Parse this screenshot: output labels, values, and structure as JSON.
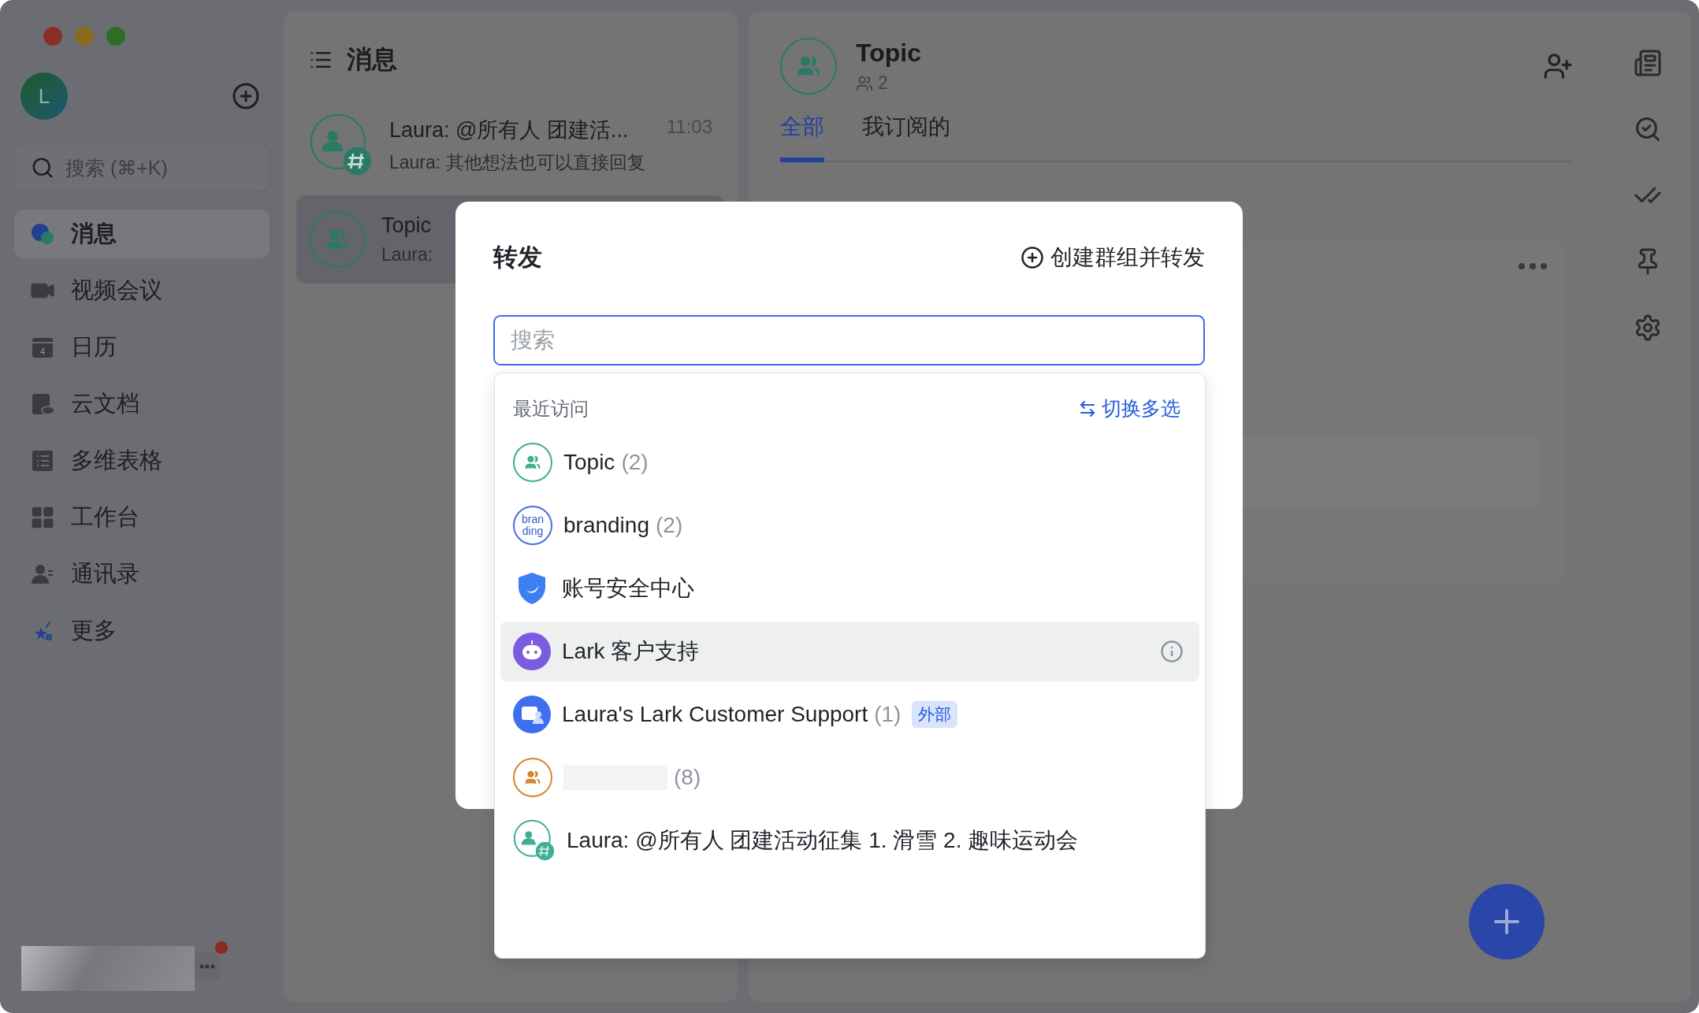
{
  "sidebar": {
    "avatar_letter": "L",
    "search": {
      "placeholder": "搜索 (⌘+K)"
    },
    "items": [
      {
        "kind": "messages",
        "label": "消息",
        "selected": true
      },
      {
        "kind": "video",
        "label": "视频会议",
        "selected": false
      },
      {
        "kind": "calendar",
        "label": "日历",
        "icon_text": "4",
        "selected": false
      },
      {
        "kind": "docs",
        "label": "云文档",
        "selected": false
      },
      {
        "kind": "base",
        "label": "多维表格",
        "selected": false
      },
      {
        "kind": "workplace",
        "label": "工作台",
        "selected": false
      },
      {
        "kind": "contacts",
        "label": "通讯录",
        "selected": false
      },
      {
        "kind": "more",
        "label": "更多",
        "selected": false
      }
    ]
  },
  "chat_list": {
    "title": "消息",
    "items": [
      {
        "kind": "topic",
        "title": "Laura: @所有人 团建活...",
        "time": "11:03",
        "preview": "Laura: 其他想法也可以直接回复",
        "selected": false
      },
      {
        "kind": "group",
        "title": "Topic",
        "preview": "Laura:",
        "selected": true
      }
    ]
  },
  "chat": {
    "title": "Topic",
    "members": "2",
    "tabs": [
      {
        "label": "全部",
        "selected": true
      },
      {
        "label": "我订阅的",
        "selected": false
      }
    ]
  },
  "dialog": {
    "title": "转发",
    "create_action": "创建群组并转发",
    "search": {
      "placeholder": "搜索"
    },
    "section_title": "最近访问",
    "toggle_action": "切换多选",
    "items": [
      {
        "kind": "group",
        "color": "#3fae95",
        "name": "Topic",
        "count": "(2)",
        "selected": false
      },
      {
        "kind": "text",
        "avatar_lines": [
          "bran",
          "ding"
        ],
        "name": "branding",
        "count": "(2)",
        "selected": false
      },
      {
        "kind": "shield",
        "name": "账号安全中心",
        "selected": false
      },
      {
        "kind": "bot",
        "name": "Lark 客户支持",
        "selected": true
      },
      {
        "kind": "service",
        "name": "Laura's Lark Customer Support",
        "count": "(1)",
        "tag": "外部",
        "selected": false
      },
      {
        "kind": "group",
        "color": "#d4862c",
        "name_hidden": true,
        "count": "(8)",
        "selected": false
      },
      {
        "kind": "topic",
        "color": "#3fae95",
        "name": "Laura: @所有人 团建活动征集 1. 滑雪 2. 趣味运动会",
        "selected": false
      }
    ]
  }
}
